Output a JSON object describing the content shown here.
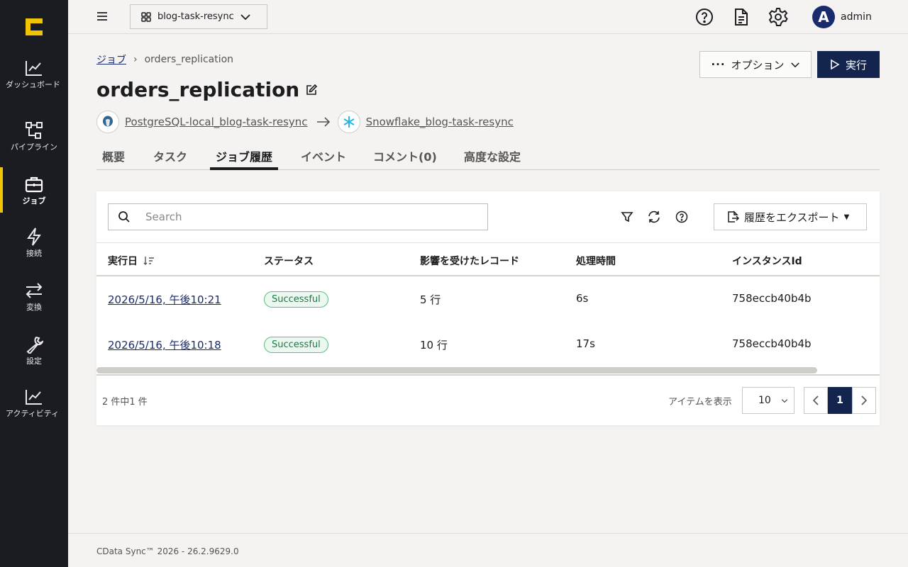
{
  "sidebar": {
    "items": [
      {
        "label": "ダッシュボード",
        "icon": "chart-line-icon"
      },
      {
        "label": "パイプライン",
        "icon": "pipeline-icon"
      },
      {
        "label": "ジョブ",
        "icon": "briefcase-icon"
      },
      {
        "label": "接続",
        "icon": "lightning-icon"
      },
      {
        "label": "変換",
        "icon": "arrows-swap-icon"
      },
      {
        "label": "設定",
        "icon": "wrench-icon"
      },
      {
        "label": "アクティビティ",
        "icon": "activity-icon"
      }
    ],
    "active_index": 2,
    "accent": "#f2c300"
  },
  "topbar": {
    "workspace": "blog-task-resync",
    "user": "admin",
    "avatar_letter": "A"
  },
  "breadcrumb": {
    "parent": "ジョブ",
    "separator": "›",
    "current": "orders_replication"
  },
  "header": {
    "title": "orders_replication",
    "options_label": "オプション",
    "run_label": "実行"
  },
  "connections": {
    "source": "PostgreSQL-local_blog-task-resync",
    "destination": "Snowflake_blog-task-resync"
  },
  "tabs": [
    "概要",
    "タスク",
    "ジョブ履歴",
    "イベント",
    "コメント(0)",
    "高度な設定"
  ],
  "active_tab": 2,
  "table": {
    "search_placeholder": "Search",
    "export_label": "履歴をエクスポート",
    "columns": [
      "実行日",
      "ステータス",
      "影響を受けたレコード",
      "処理時間",
      "インスタンスId"
    ],
    "rows": [
      {
        "date": "2026/5/16, 午後10:21",
        "status": "Successful",
        "records": "5 行",
        "duration": "6s",
        "instance": "758eccb40b4b"
      },
      {
        "date": "2026/5/16, 午後10:18",
        "status": "Successful",
        "records": "10 行",
        "duration": "17s",
        "instance": "758eccb40b4b"
      }
    ],
    "count_text": "2 件中1 件",
    "per_page_label": "アイテムを表示",
    "per_page": "10",
    "current_page": "1"
  },
  "footer": {
    "text": "CData Sync™ 2026 - 26.2.9629.0"
  }
}
